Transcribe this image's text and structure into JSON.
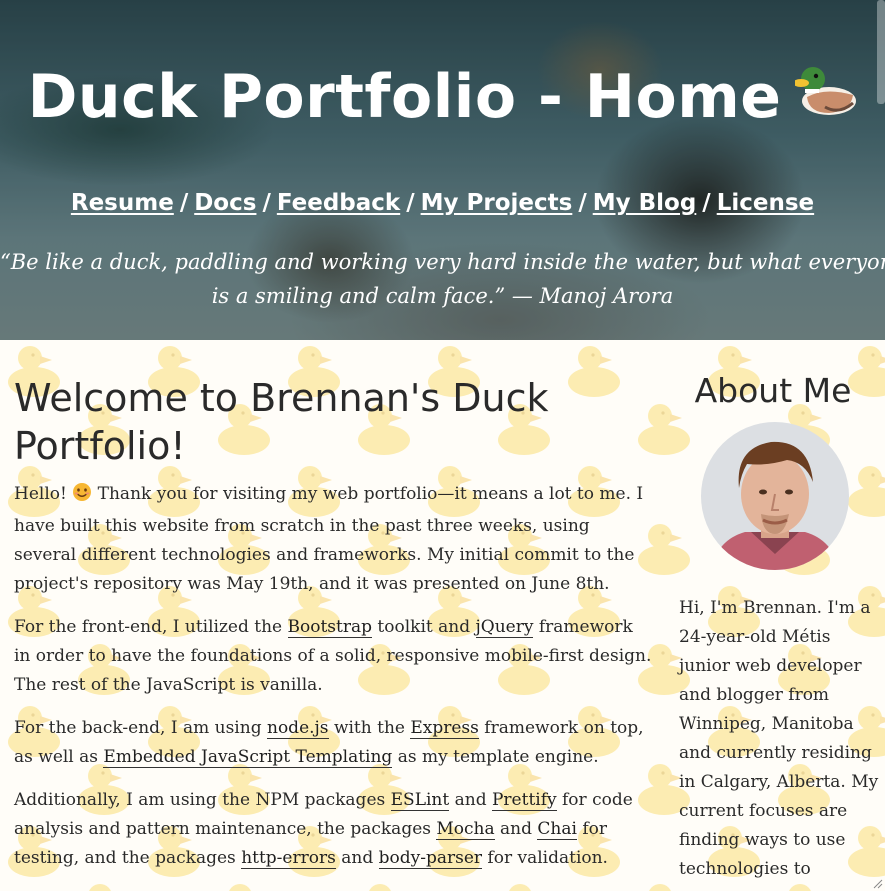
{
  "hero": {
    "title": "Duck Portfolio - Home",
    "title_icon": "duck-emoji-icon",
    "nav": [
      {
        "label": "Resume"
      },
      {
        "label": "Docs"
      },
      {
        "label": "Feedback"
      },
      {
        "label": "My Projects"
      },
      {
        "label": "My Blog"
      },
      {
        "label": "License"
      }
    ],
    "nav_separator": "/",
    "quote_line1": "“Be like a duck, paddling and working very hard inside the water, but what everyone sees",
    "quote_line2": "is a smiling and calm face.” — Manoj Arora"
  },
  "main": {
    "heading": "Welcome to Brennan's Duck Portfolio!",
    "p1": {
      "a": "Hello!",
      "icon": "smile-emoji-icon",
      "b": "Thank you for visiting my web portfolio—it means a lot to me. I have built this website from scratch in the past three weeks, using several different technologies and frameworks. My initial commit to the project's repository was May 19th, and it was presented on June 8th."
    },
    "p2": {
      "a": "For the front-end, I utilized the",
      "link1": "Bootstrap",
      "b": "toolkit and",
      "link2": "jQuery",
      "c": "framework in order to have the foundations of a solid, responsive mobile-first design. The rest of the JavaScript is vanilla."
    },
    "p3": {
      "a": "For the back-end, I am using",
      "link1": "node.js",
      "b": "with the",
      "link2": "Express",
      "c": "framework on top, as well as",
      "link3": "Embedded JavaScript Templating",
      "d": "as my template engine."
    },
    "p4": {
      "a": "Additionally, I am using the NPM packages",
      "link1": "ESLint",
      "b": "and",
      "link2": "Prettify",
      "c": "for code analysis and pattern maintenance, the packages",
      "link3": "Mocha",
      "d": "and",
      "link4": "Chai",
      "e": "for testing, and the packages",
      "link5": "http-errors",
      "f": "and",
      "link6": "body-parser",
      "g": "for validation."
    }
  },
  "sidebar": {
    "title": "About Me",
    "avatar_icon": "profile-photo",
    "bio": "Hi, I'm Brennan. I'm a 24-year-old Métis junior web developer and blogger from Winnipeg, Manitoba and currently residing in Calgary, Alberta. My current focuses are finding ways to use technologies to"
  },
  "colors": {
    "hero_text": "#ffffff",
    "body_bg": "#fffdf8",
    "pattern_duck": "#fbe9a6",
    "text": "#2a2a2a"
  }
}
